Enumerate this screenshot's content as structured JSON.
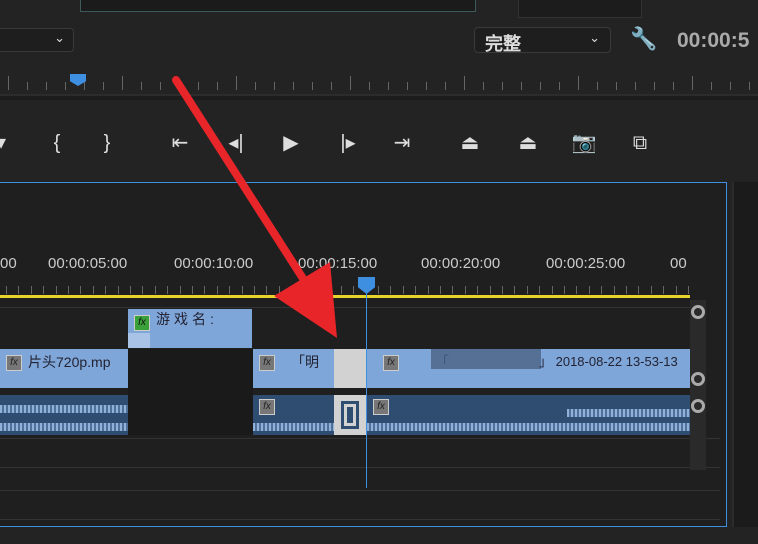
{
  "monitor": {
    "quality_select": "完整",
    "timecode": "00:00:5",
    "wrench_icon": "wrench-icon"
  },
  "controls": [
    "mark-in",
    "mark-out",
    "{",
    "}",
    "go-to-in",
    "step-back",
    "play",
    "step-forward",
    "go-to-out",
    "lift",
    "extract",
    "export-frame",
    "compare"
  ],
  "timeline": {
    "ruler_labels": [
      "00",
      "00:00:05:00",
      "00:00:10:00",
      "00:00:15:00",
      "00:00:20:00",
      "00:00:25:00",
      "00"
    ],
    "v2_clip": "游戏名:",
    "v1_clips": [
      "片头720p.mp",
      "「明",
      "「",
      "」 2018-08-22  13-53-13"
    ],
    "fx_label": "fx"
  },
  "colors": {
    "accent": "#3f8fe0",
    "clip": "#7fa6d8",
    "work_area": "#e6d42c",
    "arrow": "#e8262a"
  }
}
